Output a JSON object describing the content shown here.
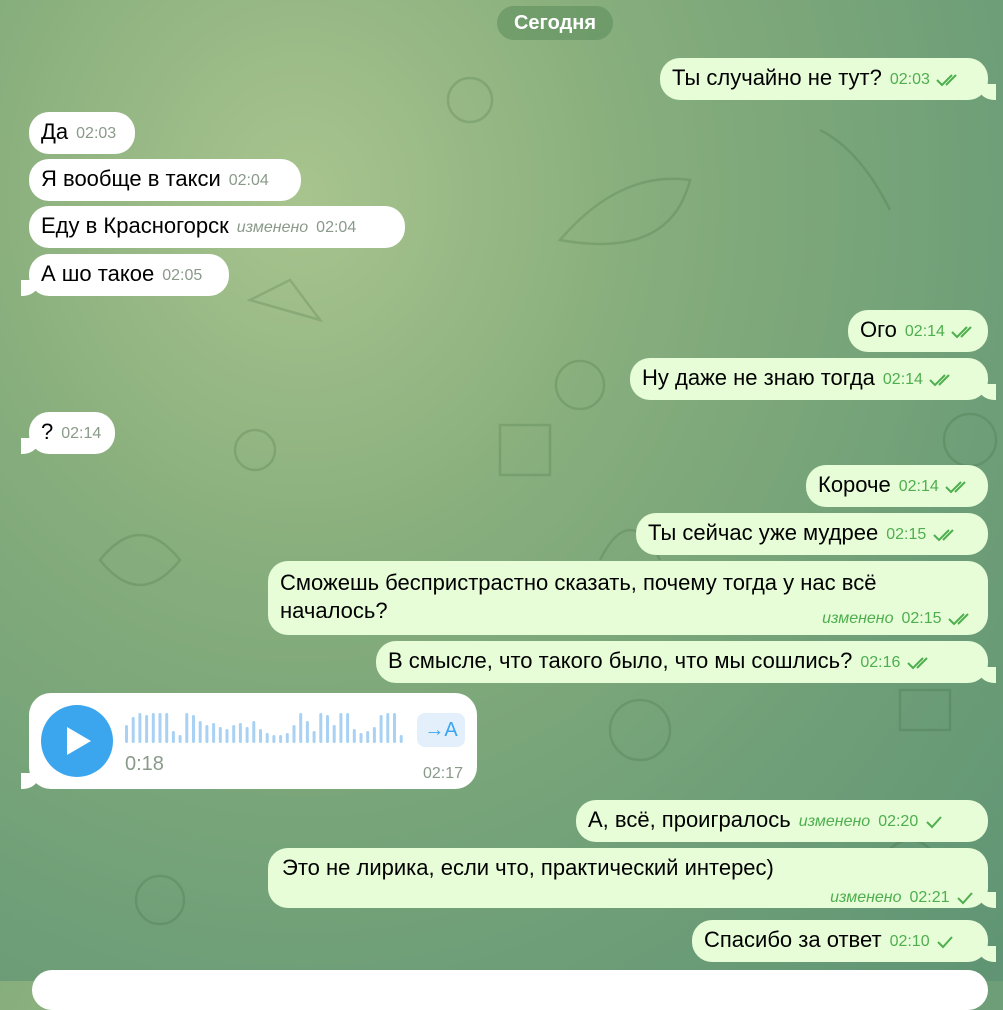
{
  "date_separator": "Сегодня",
  "messages": [
    {
      "text": "Ты случайно не тут?",
      "time": "02:03",
      "edited": "",
      "status": "read"
    },
    {
      "text": "Да",
      "time": "02:03",
      "edited": ""
    },
    {
      "text": "Я вообще в такси",
      "time": "02:04",
      "edited": ""
    },
    {
      "text": "Еду в Красногорск",
      "time": "02:04",
      "edited": "изменено"
    },
    {
      "text": "А шо такое",
      "time": "02:05",
      "edited": ""
    },
    {
      "text": "Ого",
      "time": "02:14",
      "edited": "",
      "status": "read"
    },
    {
      "text": "Ну даже не знаю тогда",
      "time": "02:14",
      "edited": "",
      "status": "read"
    },
    {
      "text": "?",
      "time": "02:14",
      "edited": ""
    },
    {
      "text": "Короче",
      "time": "02:14",
      "edited": "",
      "status": "read"
    },
    {
      "text": "Ты сейчас уже мудрее",
      "time": "02:15",
      "edited": "",
      "status": "read"
    },
    {
      "text": "Сможешь беспристрастно сказать, почему тогда у нас всё началось?",
      "time": "02:15",
      "edited": "изменено",
      "status": "read"
    },
    {
      "text": "В смысле, что такого было, что мы сошлись?",
      "time": "02:16",
      "edited": "",
      "status": "read"
    },
    {
      "text": "А, всё, проигралось",
      "time": "02:20",
      "edited": "изменено",
      "status": "sent"
    },
    {
      "text": "Это не лирика, если что, практический интерес)",
      "time": "02:21",
      "edited": "изменено",
      "status": "sent"
    },
    {
      "text": "Спасибо за ответ",
      "time": "02:10",
      "edited": "",
      "status": "sent"
    }
  ],
  "voice": {
    "duration": "0:18",
    "time": "02:17",
    "transcribe_label": "→A",
    "icon": "play-icon"
  },
  "colors": {
    "incoming": "#ffffff",
    "outgoing": "#e6fdd8",
    "meta_out": "#4fae4e",
    "accent": "#3ba6ee"
  }
}
